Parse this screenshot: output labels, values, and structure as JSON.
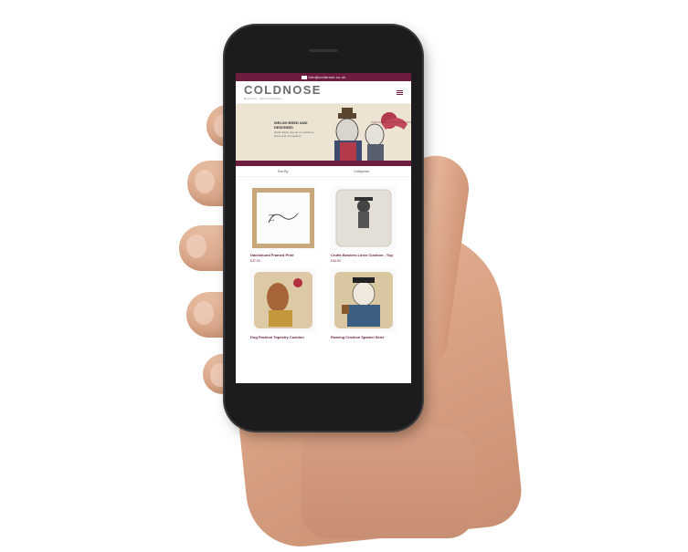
{
  "topbar": {
    "email": "info@coldnose.co.uk"
  },
  "header": {
    "logo": "COLDNOSE",
    "tagline": "Dog lovers · gifts & homewares",
    "menu_icon": "hamburger-icon"
  },
  "banner": {
    "title": "WELSH BRED AND DESIGNED",
    "subtitle": "Hand drawn dog art on cushions, prints and homewares"
  },
  "subnav": [
    "Sort By",
    "Categories"
  ],
  "products": [
    {
      "name": "Dachshund Framed Print",
      "price": "£37.00"
    },
    {
      "name": "Crufts Bowlers Linen Cushion - Top",
      "price": "£45.00"
    },
    {
      "name": "Dog Fashion Tapestry Cushion",
      "price": ""
    },
    {
      "name": "Roaring Cushion Spaniel Skier",
      "price": ""
    }
  ],
  "colors": {
    "brand": "#6d1b3f",
    "logo": "#6b6b6b",
    "banner_bg": "#ece3d3"
  }
}
